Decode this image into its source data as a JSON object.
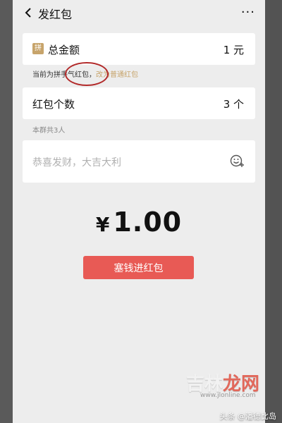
{
  "nav": {
    "title": "发红包",
    "more": "···"
  },
  "amount": {
    "badge": "拼",
    "label": "总金额",
    "value": "1 元"
  },
  "hint": {
    "prefix": "当前为",
    "current_type": "拼手气红包",
    "sep": "，",
    "switch_link": "改为普通红包"
  },
  "count": {
    "label": "红包个数",
    "value": "3 个"
  },
  "members_note": "本群共3人",
  "greeting": {
    "placeholder": "恭喜发财，大吉大利"
  },
  "summary": {
    "currency": "¥",
    "amount": "1.00"
  },
  "send_button": "塞钱进红包",
  "watermark": {
    "part1": "吉林",
    "part2": "龙网",
    "url": "www.jlonline.com"
  },
  "author": "头条 @潘德比岛",
  "colors": {
    "accent_gold": "#c7a46b",
    "send_red": "#e85a55",
    "annotation_circle": "#b22a2a"
  }
}
